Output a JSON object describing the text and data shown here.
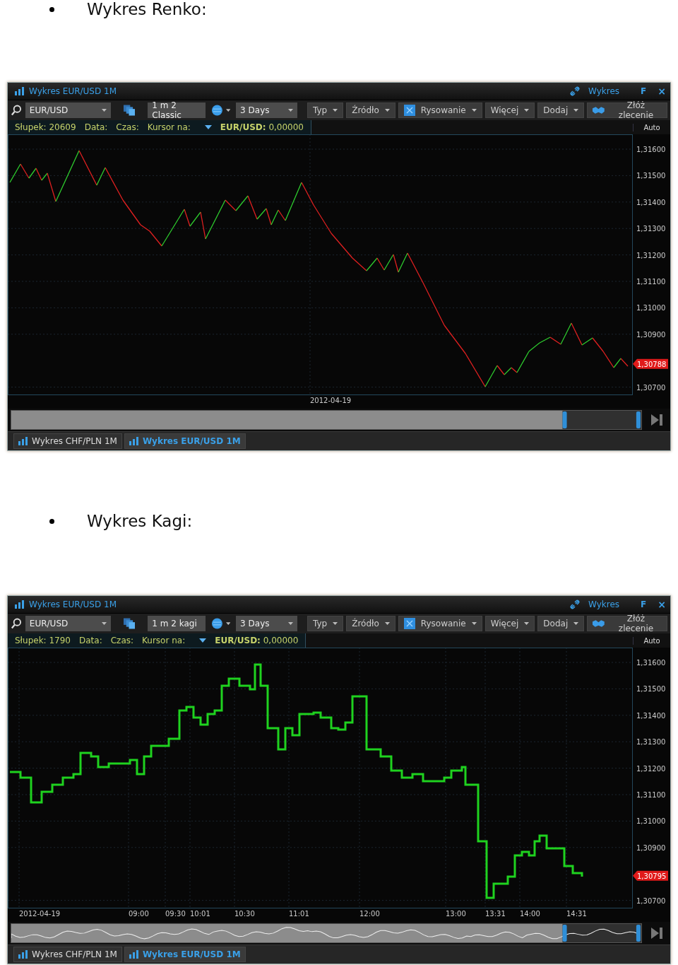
{
  "sections": [
    {
      "heading": "Wykres Renko:",
      "window": {
        "title": "Wykres EUR/USD 1M",
        "link_label": "Wykres",
        "float_label": "F",
        "close_label": "×",
        "symbol": "EUR/USD",
        "chart_type": "1 m 2 Classic",
        "range": "3 Days",
        "menus": [
          "Typ",
          "Źródło",
          "Rysowanie",
          "Więcej",
          "Dodaj"
        ],
        "order_label": "Złóż zlecenie",
        "info": {
          "bar_label": "Słupek:",
          "bar_value": "20609",
          "date_label": "Data:",
          "time_label": "Czas:",
          "cursor_label": "Kursor na:",
          "symbol_label": "EUR/USD:",
          "symbol_value": "0,00000"
        },
        "scale_mode": "Auto",
        "chart": {
          "kind": "renko",
          "y_ticks": [
            "1,31600",
            "1,31500",
            "1,31400",
            "1,31300",
            "1,31200",
            "1,31100",
            "1,31000",
            "1,30900",
            "1,30700"
          ],
          "price_tag": "1,30788",
          "x_ticks": [
            "2012-04-19"
          ]
        },
        "tabs": [
          {
            "label": "Wykres CHF/PLN 1M",
            "selected": false
          },
          {
            "label": "Wykres EUR/USD 1M",
            "selected": true
          }
        ]
      }
    },
    {
      "heading": "Wykres Kagi:",
      "window": {
        "title": "Wykres EUR/USD 1M",
        "link_label": "Wykres",
        "float_label": "F",
        "close_label": "×",
        "symbol": "EUR/USD",
        "chart_type": "1 m 2 kagi",
        "range": "3 Days",
        "menus": [
          "Typ",
          "Źródło",
          "Rysowanie",
          "Więcej",
          "Dodaj"
        ],
        "order_label": "Złóż zlecenie",
        "info": {
          "bar_label": "Słupek:",
          "bar_value": "1790",
          "date_label": "Data:",
          "time_label": "Czas:",
          "cursor_label": "Kursor na:",
          "symbol_label": "EUR/USD:",
          "symbol_value": "0,00000"
        },
        "scale_mode": "Auto",
        "chart": {
          "kind": "kagi",
          "y_ticks": [
            "1,31600",
            "1,31500",
            "1,31400",
            "1,31300",
            "1,31200",
            "1,31100",
            "1,31000",
            "1,30900",
            "1,30700"
          ],
          "price_tag": "1,30795",
          "x_ticks": [
            "2012-04-19",
            "09:00",
            "09:30",
            "10:01",
            "10:30",
            "11:01",
            "12:00",
            "13:00",
            "13:31",
            "14:00",
            "14:31"
          ]
        },
        "tabs": [
          {
            "label": "Wykres CHF/PLN 1M",
            "selected": false
          },
          {
            "label": "Wykres EUR/USD 1M",
            "selected": true
          }
        ]
      }
    }
  ]
}
